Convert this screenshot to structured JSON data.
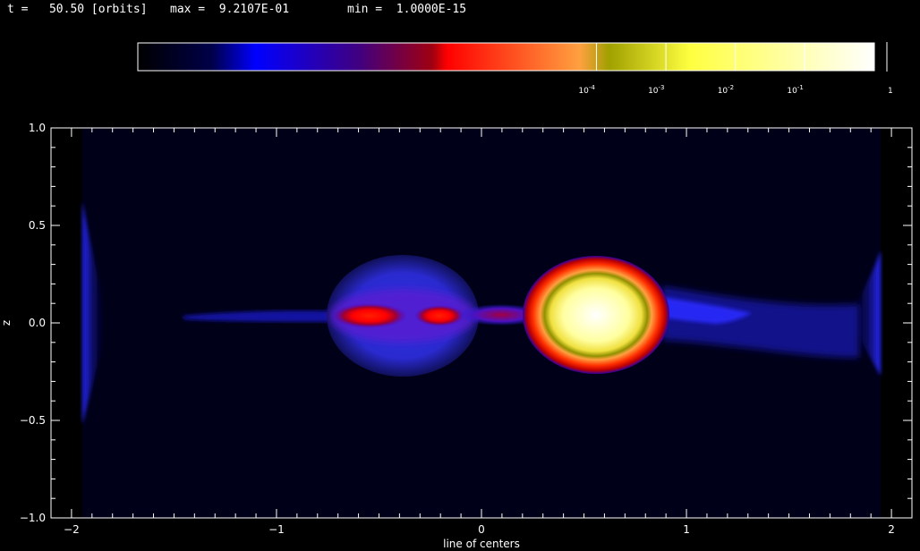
{
  "header": {
    "time_label": "t =   50.50 [orbits]",
    "max_label": "max =  9.2107E-01",
    "min_label": "min =  1.0000E-15"
  },
  "colorbar": {
    "ticks": [
      {
        "value": 0.0001,
        "label_base": "10",
        "label_exp": "-4"
      },
      {
        "value": 0.001,
        "label_base": "10",
        "label_exp": "-3"
      },
      {
        "value": 0.01,
        "label_base": "10",
        "label_exp": "-2"
      },
      {
        "value": 0.1,
        "label_base": "10",
        "label_exp": "-1"
      },
      {
        "value": 1,
        "label_base": "1",
        "label_exp": ""
      }
    ],
    "colors": [
      "#000000",
      "#000048",
      "#0000ff",
      "#400080",
      "#a00010",
      "#ff0000",
      "#ffa040",
      "#a0a000",
      "#ffff40",
      "#ffffff"
    ]
  },
  "chart_data": {
    "type": "heatmap",
    "xlabel": "line of centers",
    "ylabel": "z",
    "xlim": [
      -2.1,
      2.1
    ],
    "ylim": [
      -1.0,
      1.0
    ],
    "xticks": [
      {
        "value": -2,
        "label": "−2"
      },
      {
        "value": -1,
        "label": "−1"
      },
      {
        "value": 0,
        "label": "0"
      },
      {
        "value": 1,
        "label": "1"
      },
      {
        "value": 2,
        "label": "2"
      }
    ],
    "yticks": [
      {
        "value": 1.0,
        "label": "1.0"
      },
      {
        "value": 0.5,
        "label": "0.5"
      },
      {
        "value": 0.0,
        "label": "0.0"
      },
      {
        "value": -0.5,
        "label": "−0.5"
      },
      {
        "value": -1.0,
        "label": "−1.0"
      }
    ],
    "features": [
      {
        "name": "accretor-star",
        "x": 0.57,
        "z": 0.0,
        "rx": 0.45,
        "rz": 0.29,
        "peak_density": 0.92
      },
      {
        "name": "donor-envelope",
        "x": -0.42,
        "z": 0.03,
        "rx": 0.38,
        "rz": 0.3,
        "peak_density": 0.0003
      },
      {
        "name": "donor-core-left",
        "x": -0.58,
        "z": 0.03,
        "rx": 0.18,
        "rz": 0.05,
        "peak_density": 0.01
      },
      {
        "name": "donor-core-right",
        "x": -0.22,
        "z": 0.03,
        "rx": 0.12,
        "rz": 0.04,
        "peak_density": 0.01
      },
      {
        "name": "mass-transfer-stream",
        "x": 0.08,
        "z": 0.03,
        "rx": 0.2,
        "rz": 0.04,
        "peak_density": 0.005
      }
    ]
  }
}
